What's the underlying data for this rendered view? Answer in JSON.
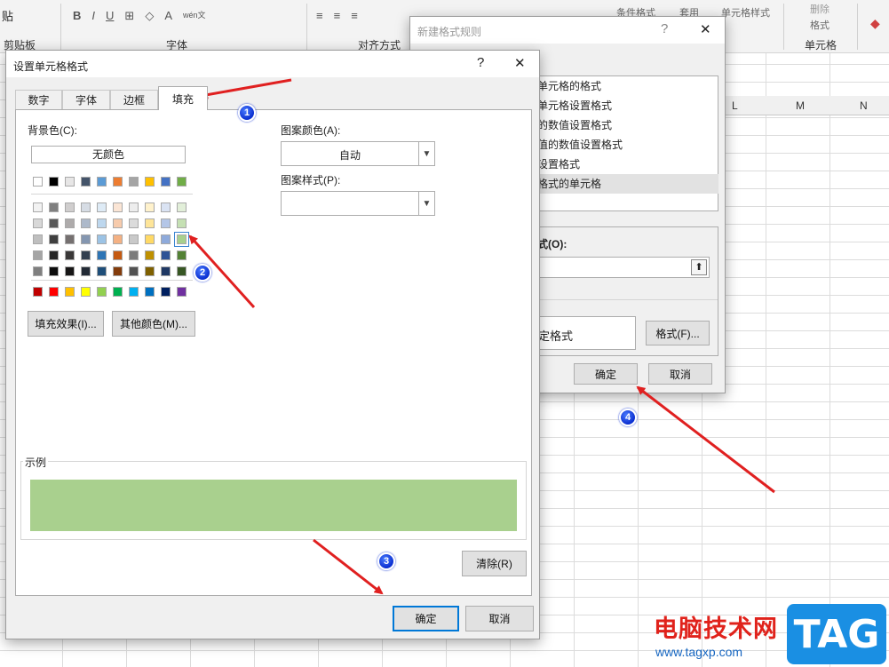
{
  "excel": {
    "ribbon": {
      "groups": [
        "剪贴板",
        "字体",
        "对齐方式",
        "单元格"
      ],
      "paste_label": "贴",
      "font_buttons": [
        "B",
        "I",
        "U",
        "A"
      ],
      "wen_button": "wén文",
      "right_items": [
        "条件格式",
        "套用",
        "单元格样式",
        "删除",
        "格式"
      ]
    },
    "columns": [
      "L",
      "M",
      "N"
    ]
  },
  "rules_dialog": {
    "title": "新建格式规则",
    "help": "?",
    "close": "✕",
    "rule_types": [
      "单元格的格式",
      "单元格设置格式",
      "的数值设置格式",
      "值的数值设置格式",
      "设置格式",
      "格式的单元格"
    ],
    "selected_index": 5,
    "edit_label": "式(O):",
    "preview_text": "定格式",
    "format_button": "格式(F)...",
    "ok": "确定",
    "cancel": "取消"
  },
  "format_dialog": {
    "title": "设置单元格格式",
    "help": "?",
    "close": "✕",
    "tabs": [
      "数字",
      "字体",
      "边框",
      "填充"
    ],
    "active_tab": "填充",
    "background_label": "背景色(C):",
    "no_color": "无颜色",
    "pattern_color_label": "图案颜色(A):",
    "pattern_color_value": "自动",
    "pattern_style_label": "图案样式(P):",
    "pattern_style_value": "",
    "fill_effects": "填充效果(I)...",
    "more_colors": "其他颜色(M)...",
    "sample_label": "示例",
    "sample_color": "#a9d08e",
    "clear": "清除(R)",
    "ok": "确定",
    "cancel": "取消",
    "theme_row": [
      "#ffffff",
      "#000000",
      "#e7e6e6",
      "#44546a",
      "#5b9bd5",
      "#ed7d31",
      "#a5a5a5",
      "#ffc000",
      "#4472c4",
      "#70ad47"
    ],
    "tint_rows": [
      [
        "#f2f2f2",
        "#7f7f7f",
        "#d0cece",
        "#d6dce4",
        "#deebf6",
        "#fbe5d5",
        "#ededed",
        "#fff2cc",
        "#dae3f3",
        "#e2efd9"
      ],
      [
        "#d8d8d8",
        "#595959",
        "#aeabab",
        "#adb9ca",
        "#bdd7ee",
        "#f7cbac",
        "#dbdbdb",
        "#fee599",
        "#b4c6e7",
        "#c5e0b3"
      ],
      [
        "#bfbfbf",
        "#3f3f3f",
        "#757070",
        "#8496b0",
        "#9cc3e5",
        "#f4b183",
        "#c9c9c9",
        "#ffd965",
        "#8eaadb",
        "#a8d08d"
      ],
      [
        "#a5a5a5",
        "#262626",
        "#3a3838",
        "#323f4f",
        "#2e75b5",
        "#c55a11",
        "#7b7b7b",
        "#bf9000",
        "#2f5496",
        "#538135"
      ],
      [
        "#7f7f7f",
        "#0c0c0c",
        "#171616",
        "#222a35",
        "#1e4e79",
        "#833c0b",
        "#525252",
        "#7f6000",
        "#1f3864",
        "#375623"
      ]
    ],
    "selected_swatch": [
      2,
      9
    ],
    "standard_row": [
      "#c00000",
      "#ff0000",
      "#ffc000",
      "#ffff00",
      "#92d050",
      "#00b050",
      "#00b0f0",
      "#0070c0",
      "#002060",
      "#7030a0"
    ]
  },
  "annotations": {
    "badges": [
      "1",
      "2",
      "3",
      "4"
    ],
    "arrow_color": "#e02020"
  },
  "watermark": {
    "text": "电脑技术网",
    "url": "www.tagxp.com",
    "tag": "TAG"
  }
}
